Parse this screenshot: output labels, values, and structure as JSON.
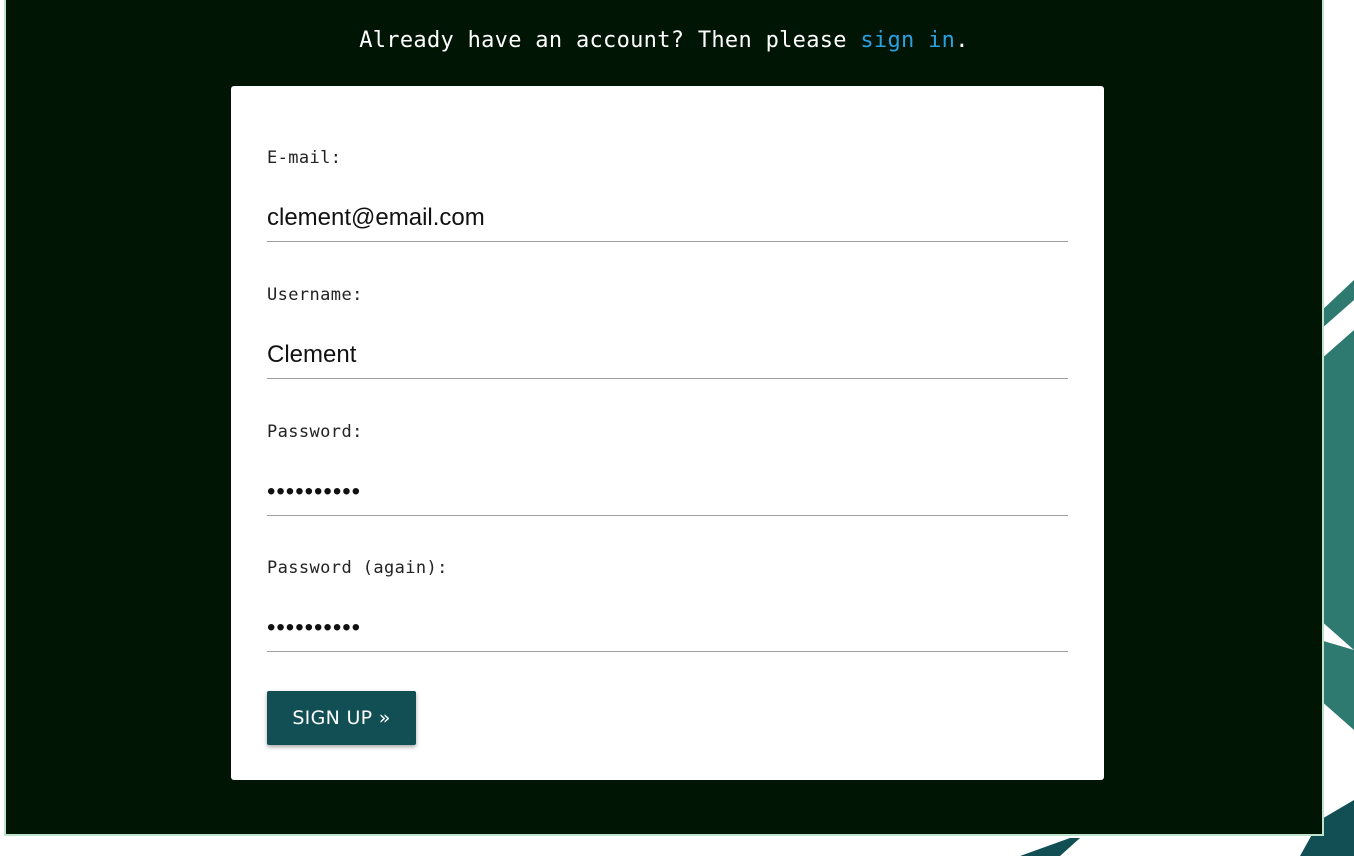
{
  "header": {
    "prompt_text": "Already have an account? Then please ",
    "signin_link": "sign in",
    "trailing": "."
  },
  "form": {
    "email": {
      "label": "E-mail:",
      "value": "clement@email.com"
    },
    "username": {
      "label": "Username:",
      "value": "Clement"
    },
    "password": {
      "label": "Password:",
      "value": "••••••••••"
    },
    "password_again": {
      "label": "Password (again):",
      "value": "••••••••••"
    },
    "submit_label": "SIGN UP »"
  },
  "colors": {
    "background": "#001503",
    "link": "#2b9fe0",
    "button": "#114f55",
    "decoration": "#2f7a70"
  }
}
